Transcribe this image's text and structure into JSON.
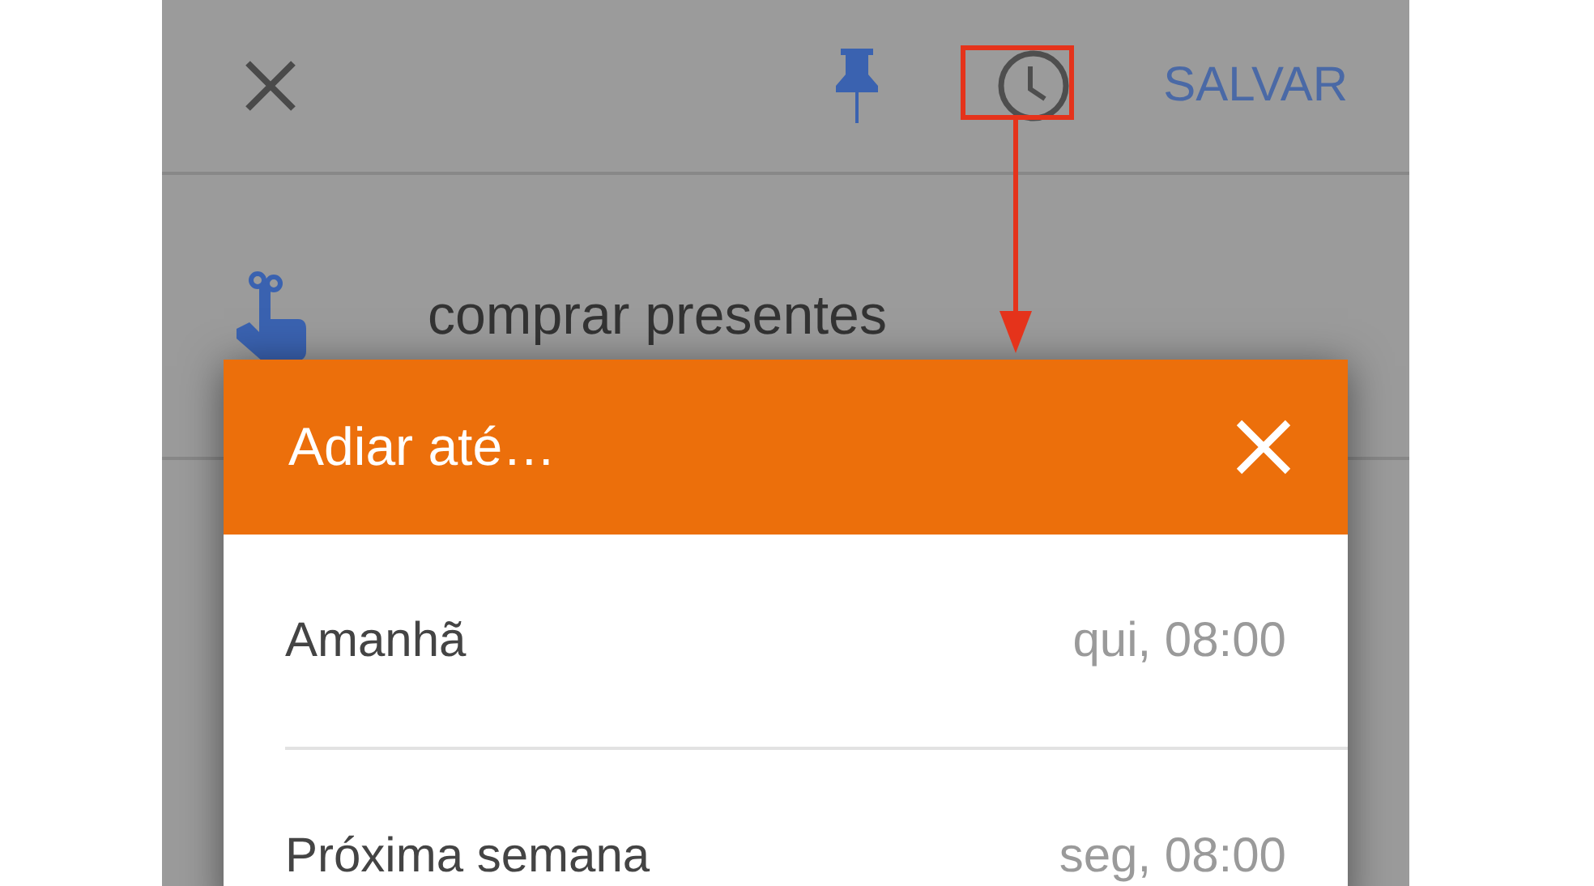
{
  "toolbar": {
    "pinned": true,
    "save_button": "SALVAR"
  },
  "note": {
    "text": "comprar presentes"
  },
  "dialog": {
    "title": "Adiar até…",
    "options": [
      {
        "label": "Amanhã",
        "time": "qui, 08:00"
      },
      {
        "label": "Próxima semana",
        "time": "seg, 08:00"
      }
    ]
  }
}
